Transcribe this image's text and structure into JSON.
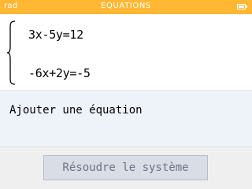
{
  "header": {
    "angle_mode": "rad",
    "title": "EQUATIONS",
    "battery_icon": "battery-full-icon"
  },
  "equations": [
    "3x-5y=12",
    "-6x+2y=-5"
  ],
  "add_equation_label": "Ajouter une équation",
  "solve_button_label": "Résoudre le système",
  "colors": {
    "title_bar": "#ffb734",
    "title_text": "#ffffff",
    "add_row_background": "#eef3fa",
    "button_background": "#d9dde6",
    "button_text": "#6c7285"
  }
}
